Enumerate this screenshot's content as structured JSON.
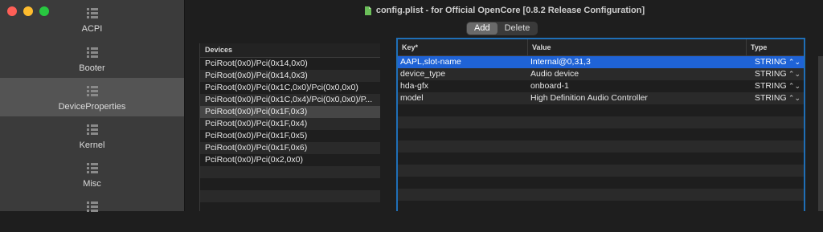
{
  "window": {
    "title": "config.plist - for Official OpenCore [0.8.2 Release Configuration]"
  },
  "sidebar": {
    "items": [
      {
        "label": "ACPI",
        "icon": "list-icon"
      },
      {
        "label": "Booter",
        "icon": "list-icon"
      },
      {
        "label": "DeviceProperties",
        "icon": "list-icon",
        "selected": true
      },
      {
        "label": "Kernel",
        "icon": "list-icon"
      },
      {
        "label": "Misc",
        "icon": "list-icon"
      },
      {
        "label": "",
        "icon": "list-icon"
      }
    ]
  },
  "toolbar": {
    "add_label": "Add",
    "delete_label": "Delete"
  },
  "devices": {
    "header": "Devices",
    "rows": [
      "PciRoot(0x0)/Pci(0x14,0x0)",
      "PciRoot(0x0)/Pci(0x14,0x3)",
      "PciRoot(0x0)/Pci(0x1C,0x0)/Pci(0x0,0x0)",
      "PciRoot(0x0)/Pci(0x1C,0x4)/Pci(0x0,0x0)/P...",
      "PciRoot(0x0)/Pci(0x1F,0x3)",
      "PciRoot(0x0)/Pci(0x1F,0x4)",
      "PciRoot(0x0)/Pci(0x1F,0x5)",
      "PciRoot(0x0)/Pci(0x1F,0x6)",
      "PciRoot(0x0)/Pci(0x2,0x0)"
    ],
    "selected_index": 4
  },
  "properties": {
    "headers": {
      "key": "Key*",
      "value": "Value",
      "type": "Type"
    },
    "rows": [
      {
        "key": "AAPL,slot-name",
        "value": "Internal@0,31,3",
        "type": "STRING"
      },
      {
        "key": "device_type",
        "value": "Audio device",
        "type": "STRING"
      },
      {
        "key": "hda-gfx",
        "value": "onboard-1",
        "type": "STRING"
      },
      {
        "key": "model",
        "value": "High Definition Audio Controller",
        "type": "STRING"
      }
    ],
    "selected_index": 0,
    "stepper_glyph": "⌃⌄"
  },
  "colors": {
    "selection_blue": "#1f63d6",
    "focus_ring": "#1f6fb7",
    "sidebar_bg": "#3b3b3b",
    "content_bg": "#1e1e1e"
  }
}
